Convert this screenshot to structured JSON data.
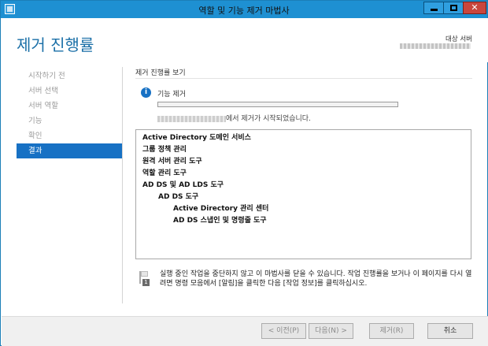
{
  "window": {
    "title": "역할 및 기능 제거 마법사",
    "controls": [
      "minimize",
      "maximize",
      "close"
    ]
  },
  "header": {
    "page_title": "제거 진행률",
    "target_label": "대상 서버",
    "target_server": "(blurred)"
  },
  "nav": {
    "items": [
      {
        "label": "시작하기 전",
        "active": false
      },
      {
        "label": "서버 선택",
        "active": false
      },
      {
        "label": "서버 역할",
        "active": false
      },
      {
        "label": "기능",
        "active": false
      },
      {
        "label": "확인",
        "active": false
      },
      {
        "label": "결과",
        "active": true
      }
    ]
  },
  "main": {
    "section_label": "제거 진행률 보기",
    "task_text": "기능 제거",
    "progress_fraction": 0,
    "status_suffix": "에서 제거가 시작되었습니다."
  },
  "features": [
    {
      "label": "Active Directory 도메인 서비스",
      "level": 0
    },
    {
      "label": "그룹 정책 관리",
      "level": 0
    },
    {
      "label": "원격 서버 관리 도구",
      "level": 0
    },
    {
      "label": "역할 관리 도구",
      "level": 1
    },
    {
      "label": "AD DS 및 AD LDS 도구",
      "level": 2
    },
    {
      "label": "AD DS 도구",
      "level": 3
    },
    {
      "label": "Active Directory 관리 센터",
      "level": 4
    },
    {
      "label": "AD DS 스냅인 및 명령줄 도구",
      "level": 4
    }
  ],
  "notice": {
    "text": "실행 중인 작업을 중단하지 않고 이 마법사를 닫을 수 있습니다. 작업 진행률을 보거나 이 페이지를 다시 열려면 명령 모음에서 [알림]을 클릭한 다음 [작업 정보]를 클릭하십시오.",
    "badge": "1"
  },
  "footer": {
    "prev_label": "< 이전(P)",
    "next_label": "다음(N) >",
    "remove_label": "제거(R)",
    "cancel_label": "취소"
  },
  "colors": {
    "titlebar": "#1e90d2",
    "accent": "#1771c4",
    "page_title": "#1a6fa7"
  }
}
